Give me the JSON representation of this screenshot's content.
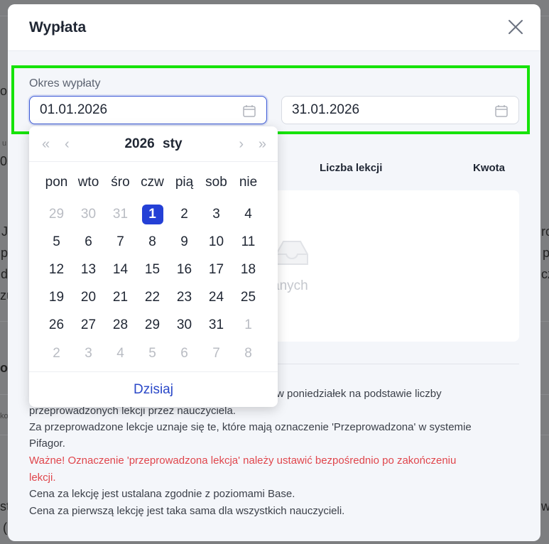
{
  "background": {
    "fragments": [
      "o",
      "u",
      "05",
      "J",
      "p",
      "d",
      "zu",
      "ro",
      "p",
      "cz",
      "or",
      "ko",
      "st",
      "(",
      "w"
    ]
  },
  "modal": {
    "title": "Wypłata",
    "payout_period": {
      "label": "Okres wypłaty",
      "start_value": "01.01.2026",
      "end_value": "31.01.2026"
    },
    "table": {
      "columns": [
        "Liczba lekcji",
        "Kwota"
      ],
      "empty_text": "anych"
    },
    "info_lines": [
      "w poniedziałek na podstawie liczby",
      "przeprowadzonych lekcji przez nauczyciela.",
      "Za przeprowadzone lekcje uznaje się te, które mają oznaczenie 'Przeprowadzona' w systemie",
      "Pifagor.",
      "Ważne! Oznaczenie 'przeprowadzona lekcja' należy ustawić bezpośrednio po zakończeniu",
      "lekcji.",
      "Cena za lekcję jest ustalana zgodnie z poziomami Base.",
      "Cena za pierwszą lekcję jest taka sama dla wszystkich nauczycieli."
    ]
  },
  "datepicker": {
    "year": "2026",
    "month": "sty",
    "nav": {
      "prev_year": "«",
      "prev_month": "‹",
      "next_month": "›",
      "next_year": "»"
    },
    "weekdays": [
      "pon",
      "wto",
      "śro",
      "czw",
      "pią",
      "sob",
      "nie"
    ],
    "days": [
      {
        "d": "29",
        "muted": true
      },
      {
        "d": "30",
        "muted": true
      },
      {
        "d": "31",
        "muted": true
      },
      {
        "d": "1",
        "selected": true
      },
      {
        "d": "2"
      },
      {
        "d": "3"
      },
      {
        "d": "4"
      },
      {
        "d": "5"
      },
      {
        "d": "6"
      },
      {
        "d": "7"
      },
      {
        "d": "8"
      },
      {
        "d": "9"
      },
      {
        "d": "10"
      },
      {
        "d": "11"
      },
      {
        "d": "12"
      },
      {
        "d": "13"
      },
      {
        "d": "14"
      },
      {
        "d": "15"
      },
      {
        "d": "16"
      },
      {
        "d": "17"
      },
      {
        "d": "18"
      },
      {
        "d": "19"
      },
      {
        "d": "20"
      },
      {
        "d": "21"
      },
      {
        "d": "22"
      },
      {
        "d": "23"
      },
      {
        "d": "24"
      },
      {
        "d": "25"
      },
      {
        "d": "26"
      },
      {
        "d": "27"
      },
      {
        "d": "28"
      },
      {
        "d": "29"
      },
      {
        "d": "30"
      },
      {
        "d": "31"
      },
      {
        "d": "1",
        "muted": true
      },
      {
        "d": "2",
        "muted": true
      },
      {
        "d": "3",
        "muted": true
      },
      {
        "d": "4",
        "muted": true
      },
      {
        "d": "5",
        "muted": true
      },
      {
        "d": "6",
        "muted": true
      },
      {
        "d": "7",
        "muted": true
      },
      {
        "d": "8",
        "muted": true
      }
    ],
    "today_label": "Dzisiaj"
  },
  "colors": {
    "highlight": "#16e30a",
    "accent": "#2440d6",
    "warning": "#e0464c"
  }
}
